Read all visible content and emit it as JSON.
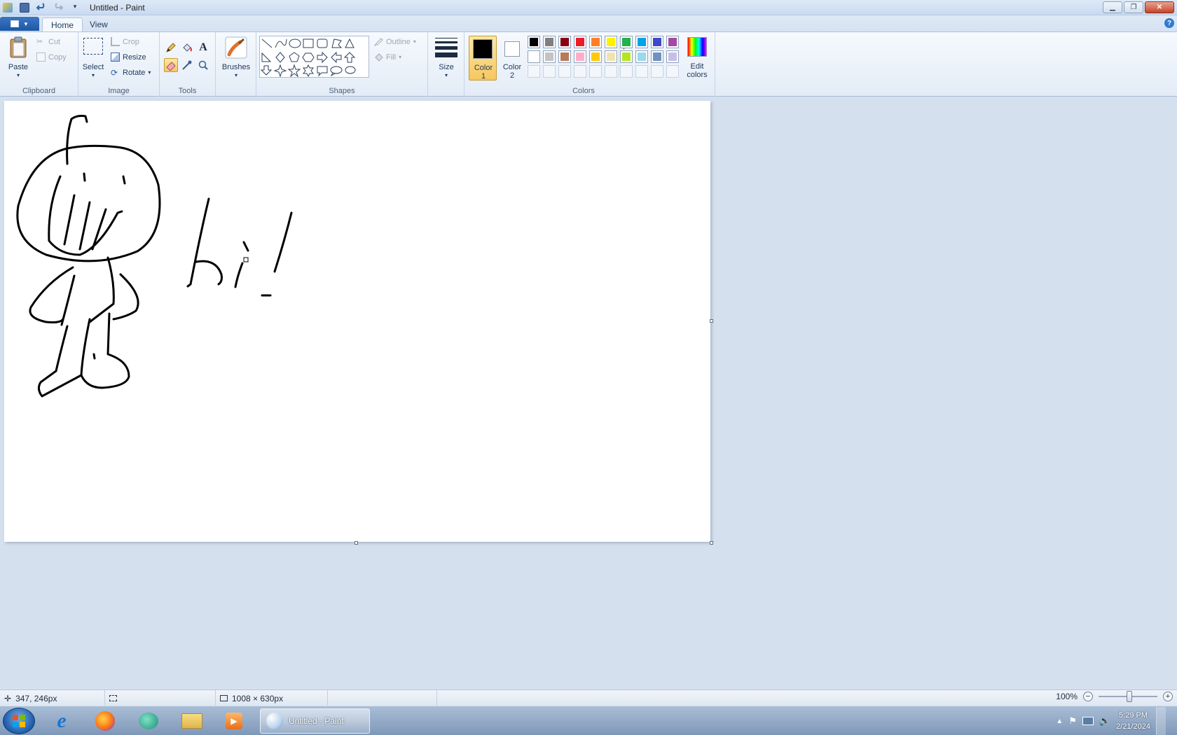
{
  "window": {
    "title": "Untitled - Paint"
  },
  "tabs": [
    {
      "label": "Home",
      "active": true
    },
    {
      "label": "View",
      "active": false
    }
  ],
  "ribbon": {
    "clipboard": {
      "group_label": "Clipboard",
      "paste": "Paste",
      "cut": "Cut",
      "copy": "Copy"
    },
    "image": {
      "group_label": "Image",
      "select": "Select",
      "crop": "Crop",
      "resize": "Resize",
      "rotate": "Rotate"
    },
    "tools": {
      "group_label": "Tools"
    },
    "brushes": {
      "label": "Brushes"
    },
    "shapes": {
      "group_label": "Shapes",
      "outline": "Outline",
      "fill": "Fill"
    },
    "size": {
      "label": "Size"
    },
    "color1": {
      "label_line1": "Color",
      "label_line2": "1",
      "value": "#000000"
    },
    "color2": {
      "label_line1": "Color",
      "label_line2": "2",
      "value": "#ffffff"
    },
    "colors": {
      "group_label": "Colors",
      "edit_line1": "Edit",
      "edit_line2": "colors"
    },
    "palette_row1": [
      "#000000",
      "#7f7f7f",
      "#880015",
      "#ed1c24",
      "#ff7f27",
      "#fff200",
      "#22b14c",
      "#00a2e8",
      "#3f48cc",
      "#a349a4"
    ],
    "palette_row2": [
      "#ffffff",
      "#c3c3c3",
      "#b97a57",
      "#ffaec9",
      "#ffc90e",
      "#efe4b0",
      "#b5e61d",
      "#99d9ea",
      "#7092be",
      "#c8bfe7"
    ]
  },
  "canvas": {
    "drawn_text": "hi!"
  },
  "status": {
    "cursor_position": "347, 246px",
    "image_size": "1008 × 630px",
    "zoom": "100%"
  },
  "taskbar": {
    "active_task": "Untitled - Paint",
    "time": "5:29 PM",
    "date": "2/21/2024"
  }
}
